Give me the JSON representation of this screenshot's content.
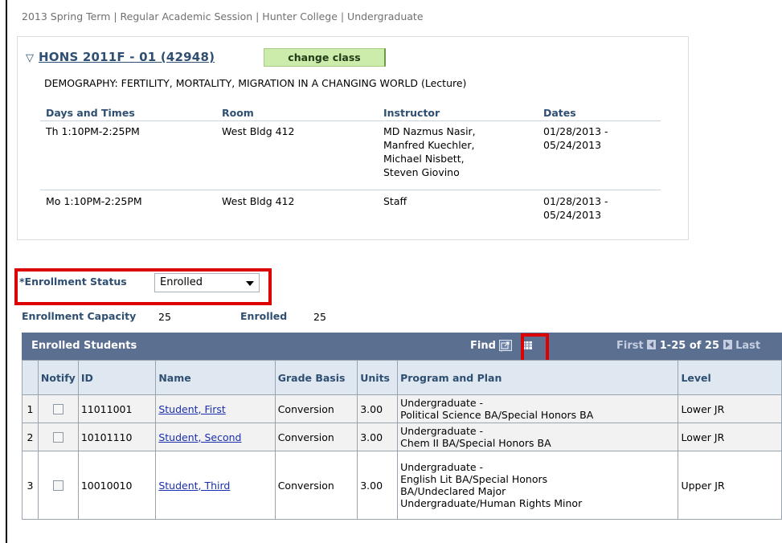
{
  "term_line": "2013 Spring Term | Regular Academic Session | Hunter College | Undergraduate",
  "class_section": {
    "collapse_icon": "triangle-down-icon",
    "class_link": "HONS 2011F - 01 (42948)",
    "change_class_label": "change class",
    "description": "DEMOGRAPHY: FERTILITY, MORTALITY, MIGRATION IN A CHANGING WORLD (Lecture)",
    "meeting_headers": [
      "Days and Times",
      "Room",
      "Instructor",
      "Dates"
    ],
    "meetings": [
      {
        "days_times": "Th 1:10PM-2:25PM",
        "room": "West Bldg 412",
        "instructors": [
          "MD Nazmus Nasir,",
          "Manfred Kuechler,",
          "Michael Nisbett,",
          "Steven Giovino"
        ],
        "dates": [
          "01/28/2013 -",
          "05/24/2013"
        ]
      },
      {
        "days_times": "Mo 1:10PM-2:25PM",
        "room": "West Bldg 412",
        "instructors": [
          "Staff"
        ],
        "dates": [
          "01/28/2013 -",
          "05/24/2013"
        ]
      }
    ]
  },
  "enrollment": {
    "status_label": "*Enrollment Status",
    "status_value": "Enrolled",
    "capacity_label": "Enrollment Capacity",
    "capacity_value": "25",
    "enrolled_label": "Enrolled",
    "enrolled_value": "25"
  },
  "grid": {
    "title": "Enrolled Students",
    "find_label": "Find",
    "find_separator": "|",
    "view_all_icon": "new-window-icon",
    "download_icon": "grid-download-icon",
    "first_label": "First",
    "range_label": "1-25 of 25",
    "last_label": "Last",
    "columns": [
      "",
      "Notify",
      "ID",
      "Name",
      "Grade Basis",
      "Units",
      "Program and Plan",
      "Level"
    ],
    "rows": [
      {
        "num": "1",
        "id": "11011001",
        "name": "Student, First",
        "grade_basis": "Conversion",
        "units": "3.00",
        "program_lines": [
          "Undergraduate -",
          "Political Science BA/Special Honors BA"
        ],
        "level": "Lower JR"
      },
      {
        "num": "2",
        "id": "10101110",
        "name": "Student, Second",
        "grade_basis": "Conversion",
        "units": "3.00",
        "program_lines": [
          "Undergraduate -",
          "Chem II BA/Special Honors BA"
        ],
        "level": "Lower JR"
      },
      {
        "num": "3",
        "id": "10010010",
        "name": "Student, Third",
        "grade_basis": "Conversion",
        "units": "3.00",
        "program_lines": [
          "Undergraduate -",
          "English Lit BA/Special Honors",
          "BA/Undeclared Major",
          "Undergraduate/Human Rights Minor"
        ],
        "level": "Upper JR"
      }
    ]
  },
  "colors": {
    "highlight_red": "#dd0000",
    "header_blue": "#5b6f91",
    "label_blue": "#2f4f72",
    "button_green": "#ccecab"
  }
}
